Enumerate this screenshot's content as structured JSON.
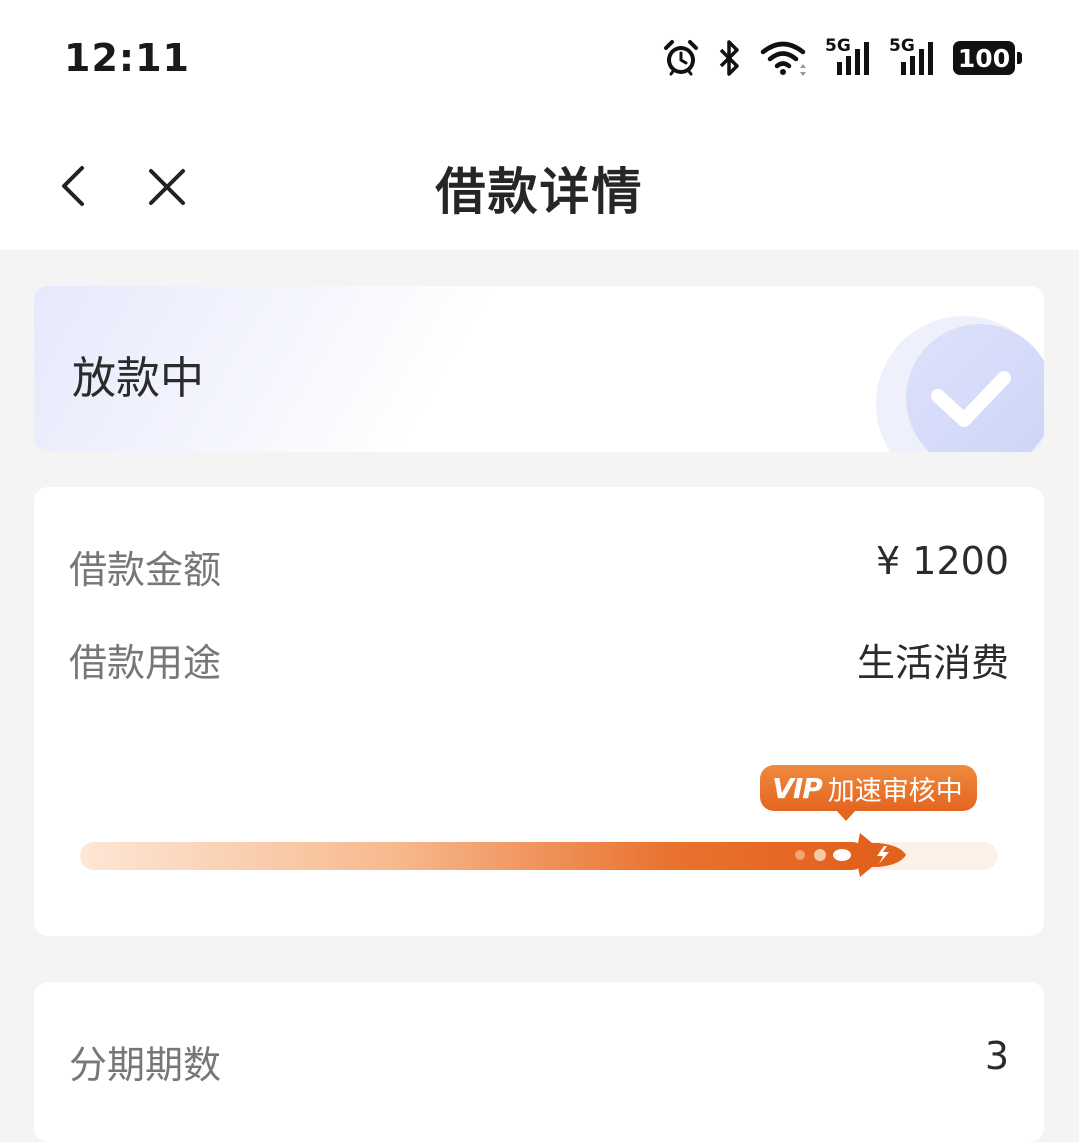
{
  "status_bar": {
    "time": "12:11",
    "network1": "5G",
    "network2": "5G",
    "battery": "100",
    "icons": [
      "alarm-icon",
      "bluetooth-icon",
      "wifi-icon",
      "signal-5g-icon",
      "signal-5g-icon",
      "battery-icon"
    ]
  },
  "nav": {
    "title": "借款详情",
    "back_icon": "chevron-left-icon",
    "close_icon": "close-icon"
  },
  "status": {
    "text": "放款中",
    "icon": "check-circle-icon"
  },
  "details": {
    "amount_label": "借款金额",
    "amount_value": "¥ 1200",
    "purpose_label": "借款用途",
    "purpose_value": "生活消费",
    "progress_fraction": 0.9,
    "vip_logo": "VIP",
    "vip_text": "加速审核中"
  },
  "installments": {
    "label": "分期期数",
    "value": "3"
  },
  "colors": {
    "accent_orange": "#e4651f",
    "status_gradient": "#e6e9fc"
  }
}
